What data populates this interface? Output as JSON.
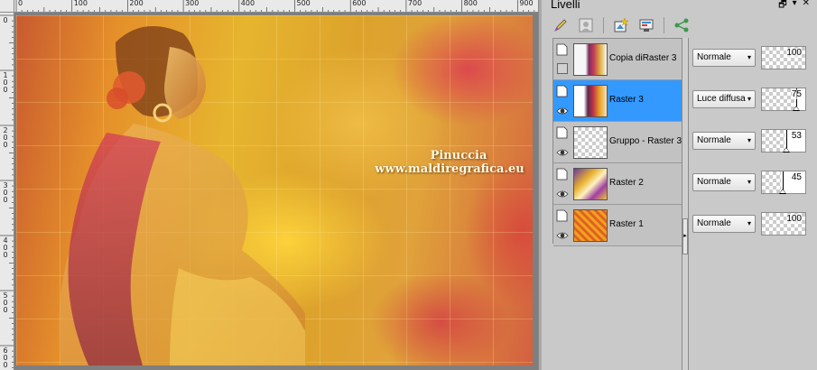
{
  "rulers": {
    "top_labels": [
      "0",
      "100",
      "200",
      "300",
      "400",
      "500",
      "600",
      "700",
      "800",
      "900"
    ],
    "left_labels": [
      "0",
      "1\n0\n0",
      "2\n0\n0",
      "3\n0\n0",
      "4\n0\n0",
      "5\n0\n0",
      "6\n0\n0"
    ]
  },
  "image": {
    "watermark_line1": "Pinuccia",
    "watermark_line2": "www.maldiregrafica.eu"
  },
  "panel": {
    "title": "Livelli",
    "pin_icon": "pin-icon",
    "menu_icon": "dropdown-icon",
    "close_icon": "close-icon",
    "toolbar": [
      {
        "name": "edit-brush-icon"
      },
      {
        "name": "mask-icon"
      },
      {
        "name": "new-layer-icon"
      },
      {
        "name": "layer-properties-icon"
      },
      {
        "name": "link-share-icon"
      }
    ]
  },
  "layers": [
    {
      "name": "Copia diRaster 3",
      "blend": "Normale",
      "opacity": 100,
      "visible": false,
      "selected": false,
      "thumb": "woman"
    },
    {
      "name": "Raster 3",
      "blend": "Luce diffusa",
      "opacity": 75,
      "visible": true,
      "selected": true,
      "thumb": "woman-color"
    },
    {
      "name": "Gruppo - Raster 3",
      "blend": "Normale",
      "opacity": 53,
      "visible": true,
      "selected": false,
      "thumb": "empty"
    },
    {
      "name": "Raster 2",
      "blend": "Normale",
      "opacity": 45,
      "visible": true,
      "selected": false,
      "thumb": "purple-yellow"
    },
    {
      "name": "Raster 1",
      "blend": "Normale",
      "opacity": 100,
      "visible": true,
      "selected": false,
      "thumb": "orange"
    }
  ],
  "colors": {
    "selection": "#3399ff",
    "panel_bg": "#c9c9c9"
  }
}
